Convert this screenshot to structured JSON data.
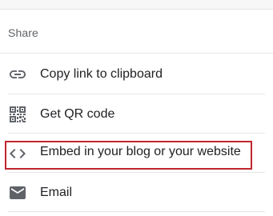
{
  "share_panel": {
    "header": "Share",
    "items": [
      {
        "label": "Copy link to clipboard",
        "icon": "link-icon"
      },
      {
        "label": "Get QR code",
        "icon": "qr-code-icon"
      },
      {
        "label": "Embed in your blog or your website",
        "icon": "code-icon"
      },
      {
        "label": "Email",
        "icon": "email-icon"
      }
    ],
    "highlighted_item": "Embed in your blog or your website",
    "colors": {
      "icon": "#5f6368",
      "text": "#202124",
      "header": "#5f6368",
      "highlight_border": "#c0262d",
      "divider": "#e6e6e6"
    }
  }
}
